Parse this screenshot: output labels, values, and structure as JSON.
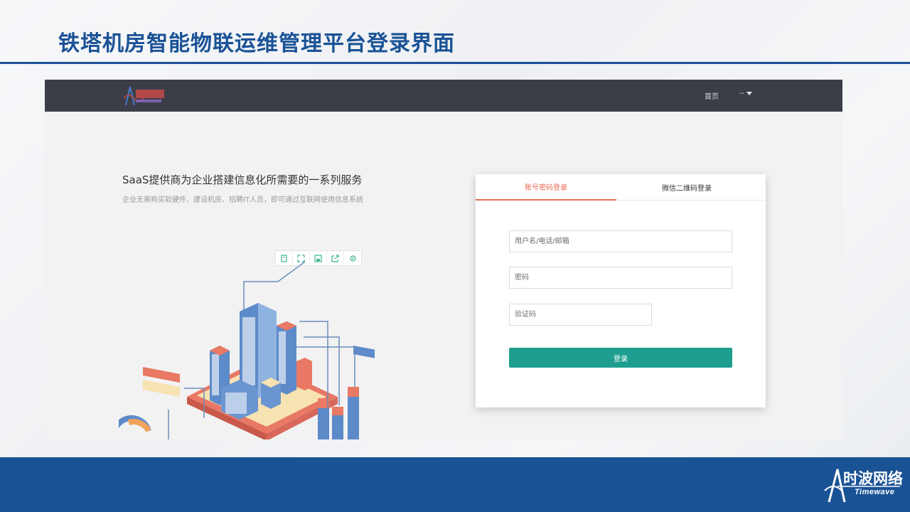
{
  "slide": {
    "title": "铁塔机房智能物联运维管理平台登录界面"
  },
  "app": {
    "nav": {
      "home_label": "首页",
      "user_label": "--"
    },
    "hero": {
      "title": "SaaS提供商为企业搭建信息化所需要的一系列服务",
      "subtitle": "企业无需购买软硬件、建设机房、招聘IT人员，即可通过互联网使用信息系统"
    },
    "login": {
      "tabs": [
        {
          "label": "账号密码登录",
          "active": true
        },
        {
          "label": "微信二维码登录",
          "active": false
        }
      ],
      "username_placeholder": "用户名/电话/邮箱",
      "password_placeholder": "密码",
      "captcha_placeholder": "验证码",
      "submit_label": "登录"
    },
    "colors": {
      "topbar": "#3c3e47",
      "accent": "#e86a55",
      "button": "#1e9e8f"
    }
  },
  "footer": {
    "brand_cn": "时波网络",
    "brand_en": "Timewave"
  },
  "theme": {
    "primary": "#1a5296"
  }
}
